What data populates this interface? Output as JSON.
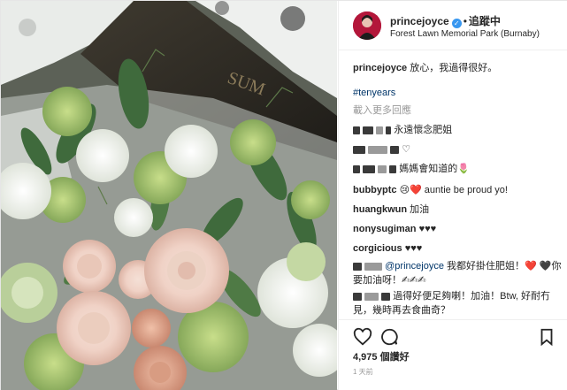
{
  "post": {
    "username": "princejoyce",
    "follow_label": "追蹤中",
    "location": "Forest Lawn Memorial Park (Burnaby)"
  },
  "photo": {
    "plaque_text": "SUM"
  },
  "caption": {
    "username": "princejoyce",
    "text": "放心，我過得很好。",
    "hashtag": "#tenyears"
  },
  "load_more": "載入更多回應",
  "comments": [
    {
      "user": "",
      "text": "永遠懷念肥姐"
    },
    {
      "user": "",
      "text": "♡"
    },
    {
      "user": "",
      "text": "媽媽會知道的🌷"
    },
    {
      "user": "bubbyptc",
      "text": "😢❤️ auntie be proud yo!"
    },
    {
      "user": "huangkwun",
      "text": "加油"
    },
    {
      "user": "nonysugiman",
      "text": "♥♥♥"
    },
    {
      "user": "corgicious",
      "text": "♥♥♥"
    },
    {
      "user": "",
      "mention": "@princejoyce",
      "text": "我都好掛住肥姐！❤️ 🖤你要加油呀！✍✍✍"
    },
    {
      "user": "",
      "text": "過得好便足夠喇！加油！Btw, 好耐冇見，幾時再去食曲奇？"
    }
  ],
  "stats": {
    "likes": "4,975 個讚好",
    "time": "1 天前"
  },
  "colors": {
    "accent_link": "#003569",
    "verified": "#3897f0",
    "muted": "#999999"
  },
  "icons": [
    "heart-icon",
    "comment-icon",
    "bookmark-icon",
    "verified-badge-icon"
  ]
}
